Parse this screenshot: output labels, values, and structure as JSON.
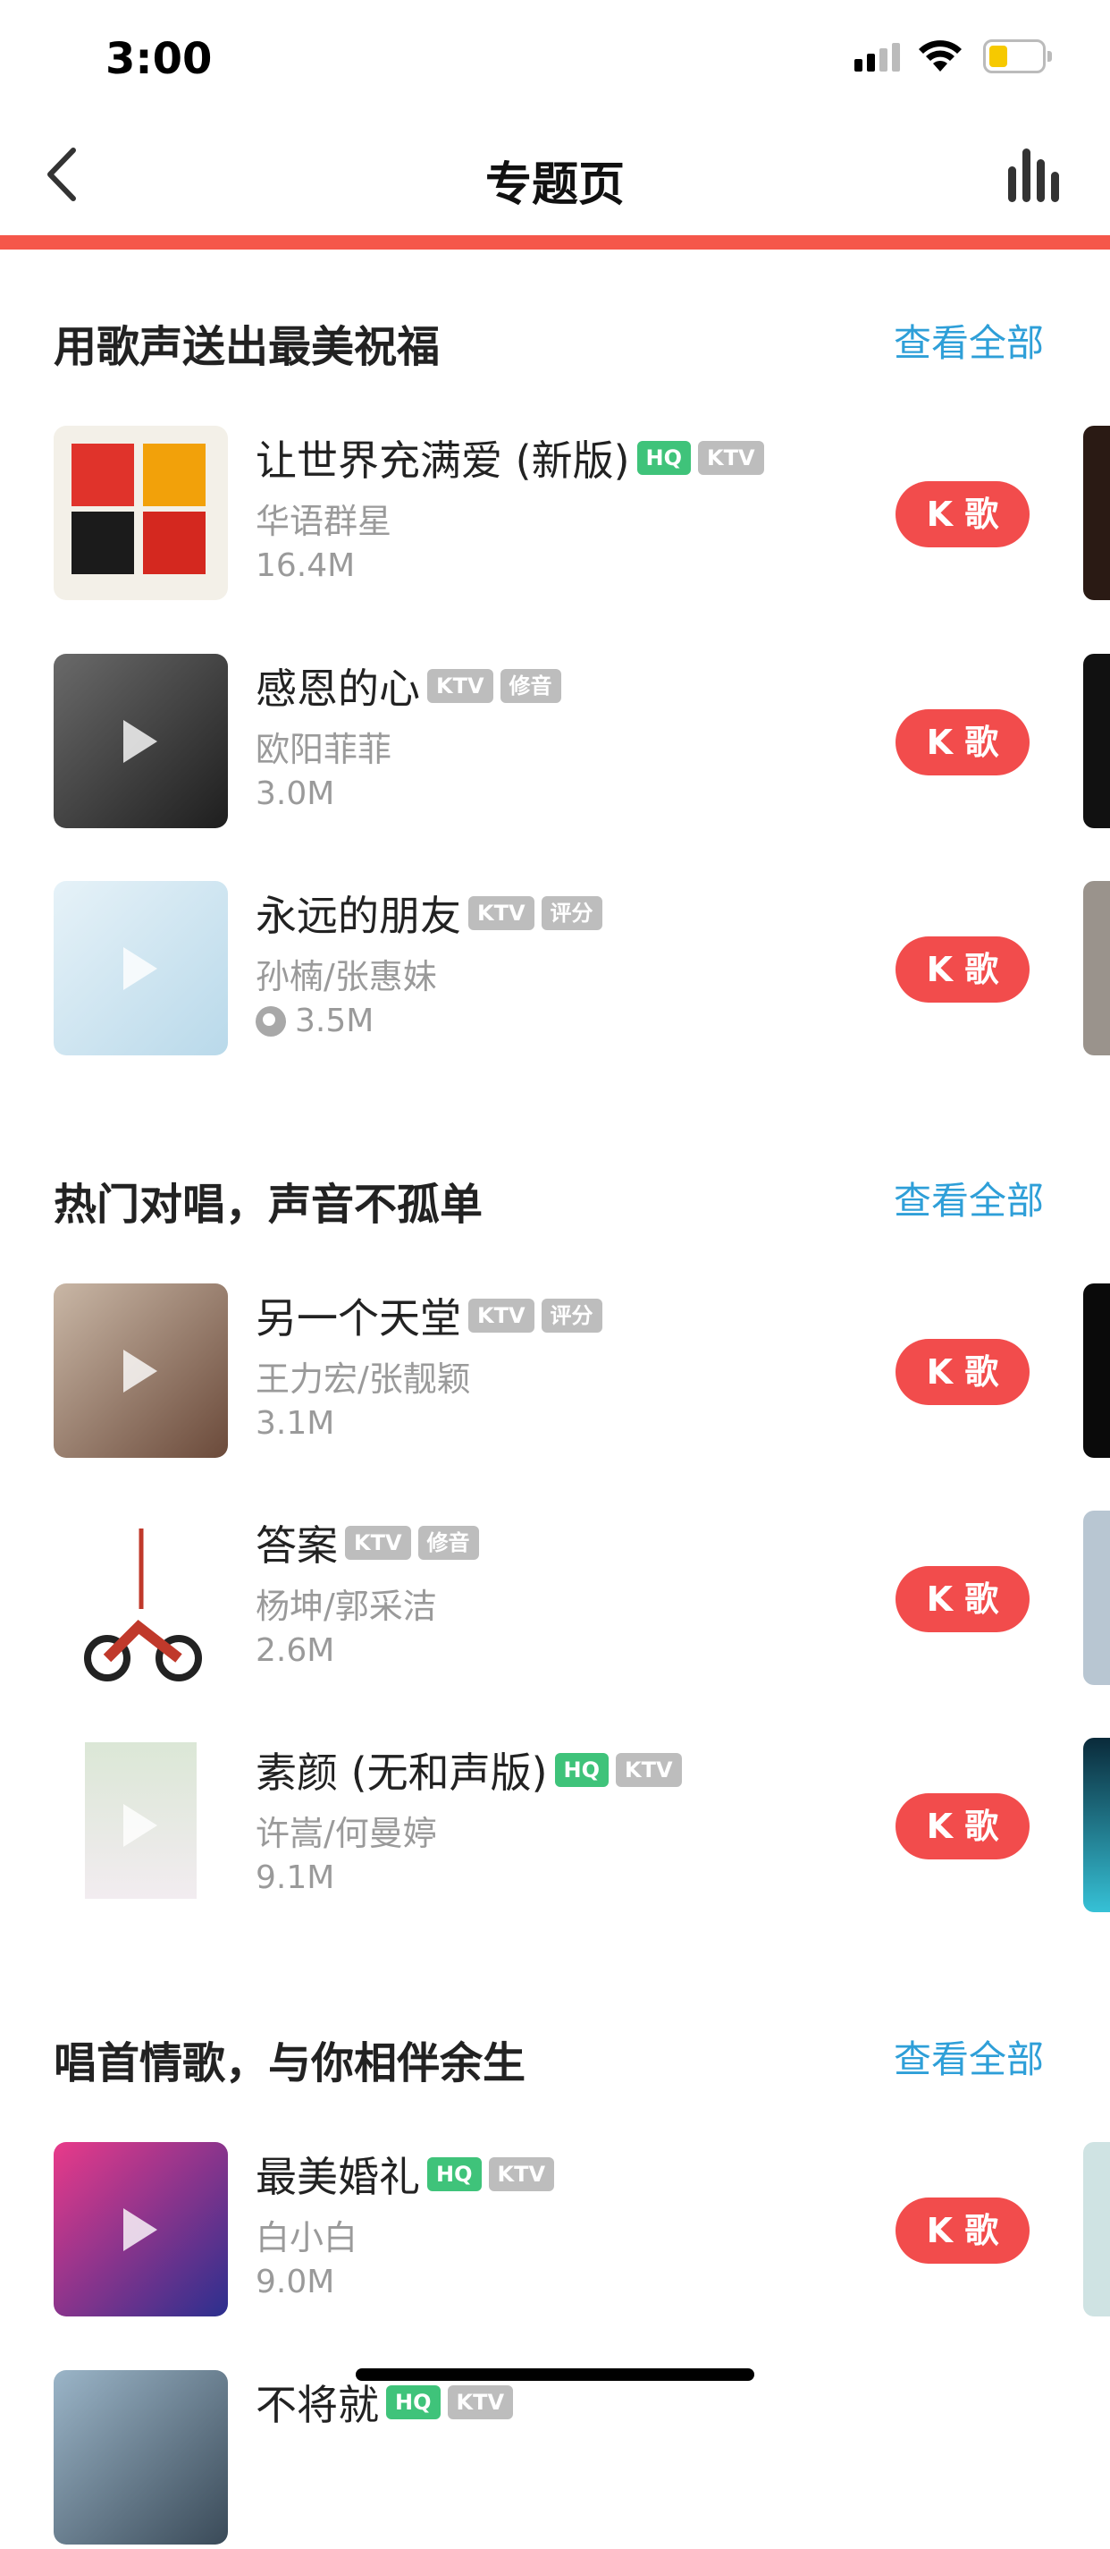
{
  "status_bar": {
    "time": "3:00"
  },
  "nav": {
    "title": "专题页"
  },
  "sections": [
    {
      "title": "用歌声送出最美祝福",
      "view_all": "查看全部",
      "songs": [
        {
          "title": "让世界充满爱 (新版)",
          "tags": [
            "HQ",
            "KTV"
          ],
          "artist": "华语群星",
          "size": "16.4M",
          "button": "K 歌"
        },
        {
          "title": "感恩的心",
          "tags": [
            "KTV",
            "修音"
          ],
          "artist": "欧阳菲菲",
          "size": "3.0M",
          "button": "K 歌"
        },
        {
          "title": "永远的朋友",
          "tags": [
            "KTV",
            "评分"
          ],
          "artist": "孙楠/张惠妹",
          "size": "3.5M",
          "button": "K 歌"
        }
      ]
    },
    {
      "title": "热门对唱，声音不孤单",
      "view_all": "查看全部",
      "songs": [
        {
          "title": "另一个天堂",
          "tags": [
            "KTV",
            "评分"
          ],
          "artist": "王力宏/张靓颖",
          "size": "3.1M",
          "button": "K 歌"
        },
        {
          "title": "答案",
          "tags": [
            "KTV",
            "修音"
          ],
          "artist": "杨坤/郭采洁",
          "size": "2.6M",
          "button": "K 歌"
        },
        {
          "title": "素颜 (无和声版)",
          "tags": [
            "HQ",
            "KTV"
          ],
          "artist": "许嵩/何曼婷",
          "size": "9.1M",
          "button": "K 歌"
        }
      ]
    },
    {
      "title": "唱首情歌，与你相伴余生",
      "view_all": "查看全部",
      "songs": [
        {
          "title": "最美婚礼",
          "tags": [
            "HQ",
            "KTV"
          ],
          "artist": "白小白",
          "size": "9.0M",
          "button": "K 歌"
        },
        {
          "title": "不将就",
          "tags": [
            "HQ",
            "KTV"
          ],
          "artist": "",
          "size": "",
          "button": ""
        }
      ]
    }
  ],
  "colors": {
    "accent": "#f5574a",
    "link": "#2e9fd8",
    "hq": "#3fc37a",
    "tag_gray": "#bdbdbd",
    "k_button": "#f24c4c"
  }
}
